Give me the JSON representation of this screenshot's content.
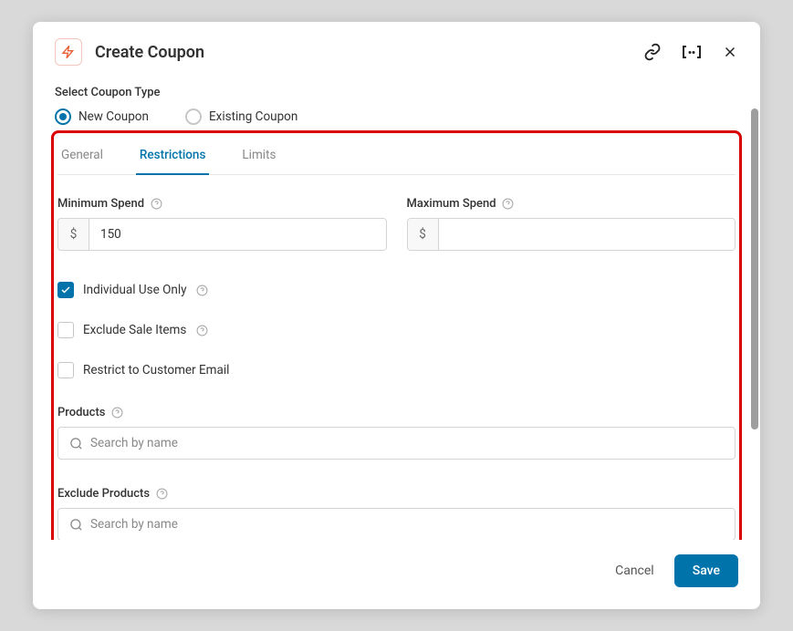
{
  "header": {
    "title": "Create Coupon"
  },
  "couponType": {
    "sectionLabel": "Select Coupon Type",
    "newCoupon": "New Coupon",
    "existingCoupon": "Existing Coupon"
  },
  "tabs": {
    "general": "General",
    "restrictions": "Restrictions",
    "limits": "Limits"
  },
  "fields": {
    "minSpend": {
      "label": "Minimum Spend",
      "currency": "$",
      "value": "150"
    },
    "maxSpend": {
      "label": "Maximum Spend",
      "currency": "$",
      "value": ""
    },
    "individualUse": "Individual Use Only",
    "excludeSale": "Exclude Sale Items",
    "restrictEmail": "Restrict to Customer Email",
    "products": {
      "label": "Products",
      "placeholder": "Search by name"
    },
    "excludeProducts": {
      "label": "Exclude Products",
      "placeholder": "Search by name"
    }
  },
  "footer": {
    "cancel": "Cancel",
    "save": "Save"
  }
}
